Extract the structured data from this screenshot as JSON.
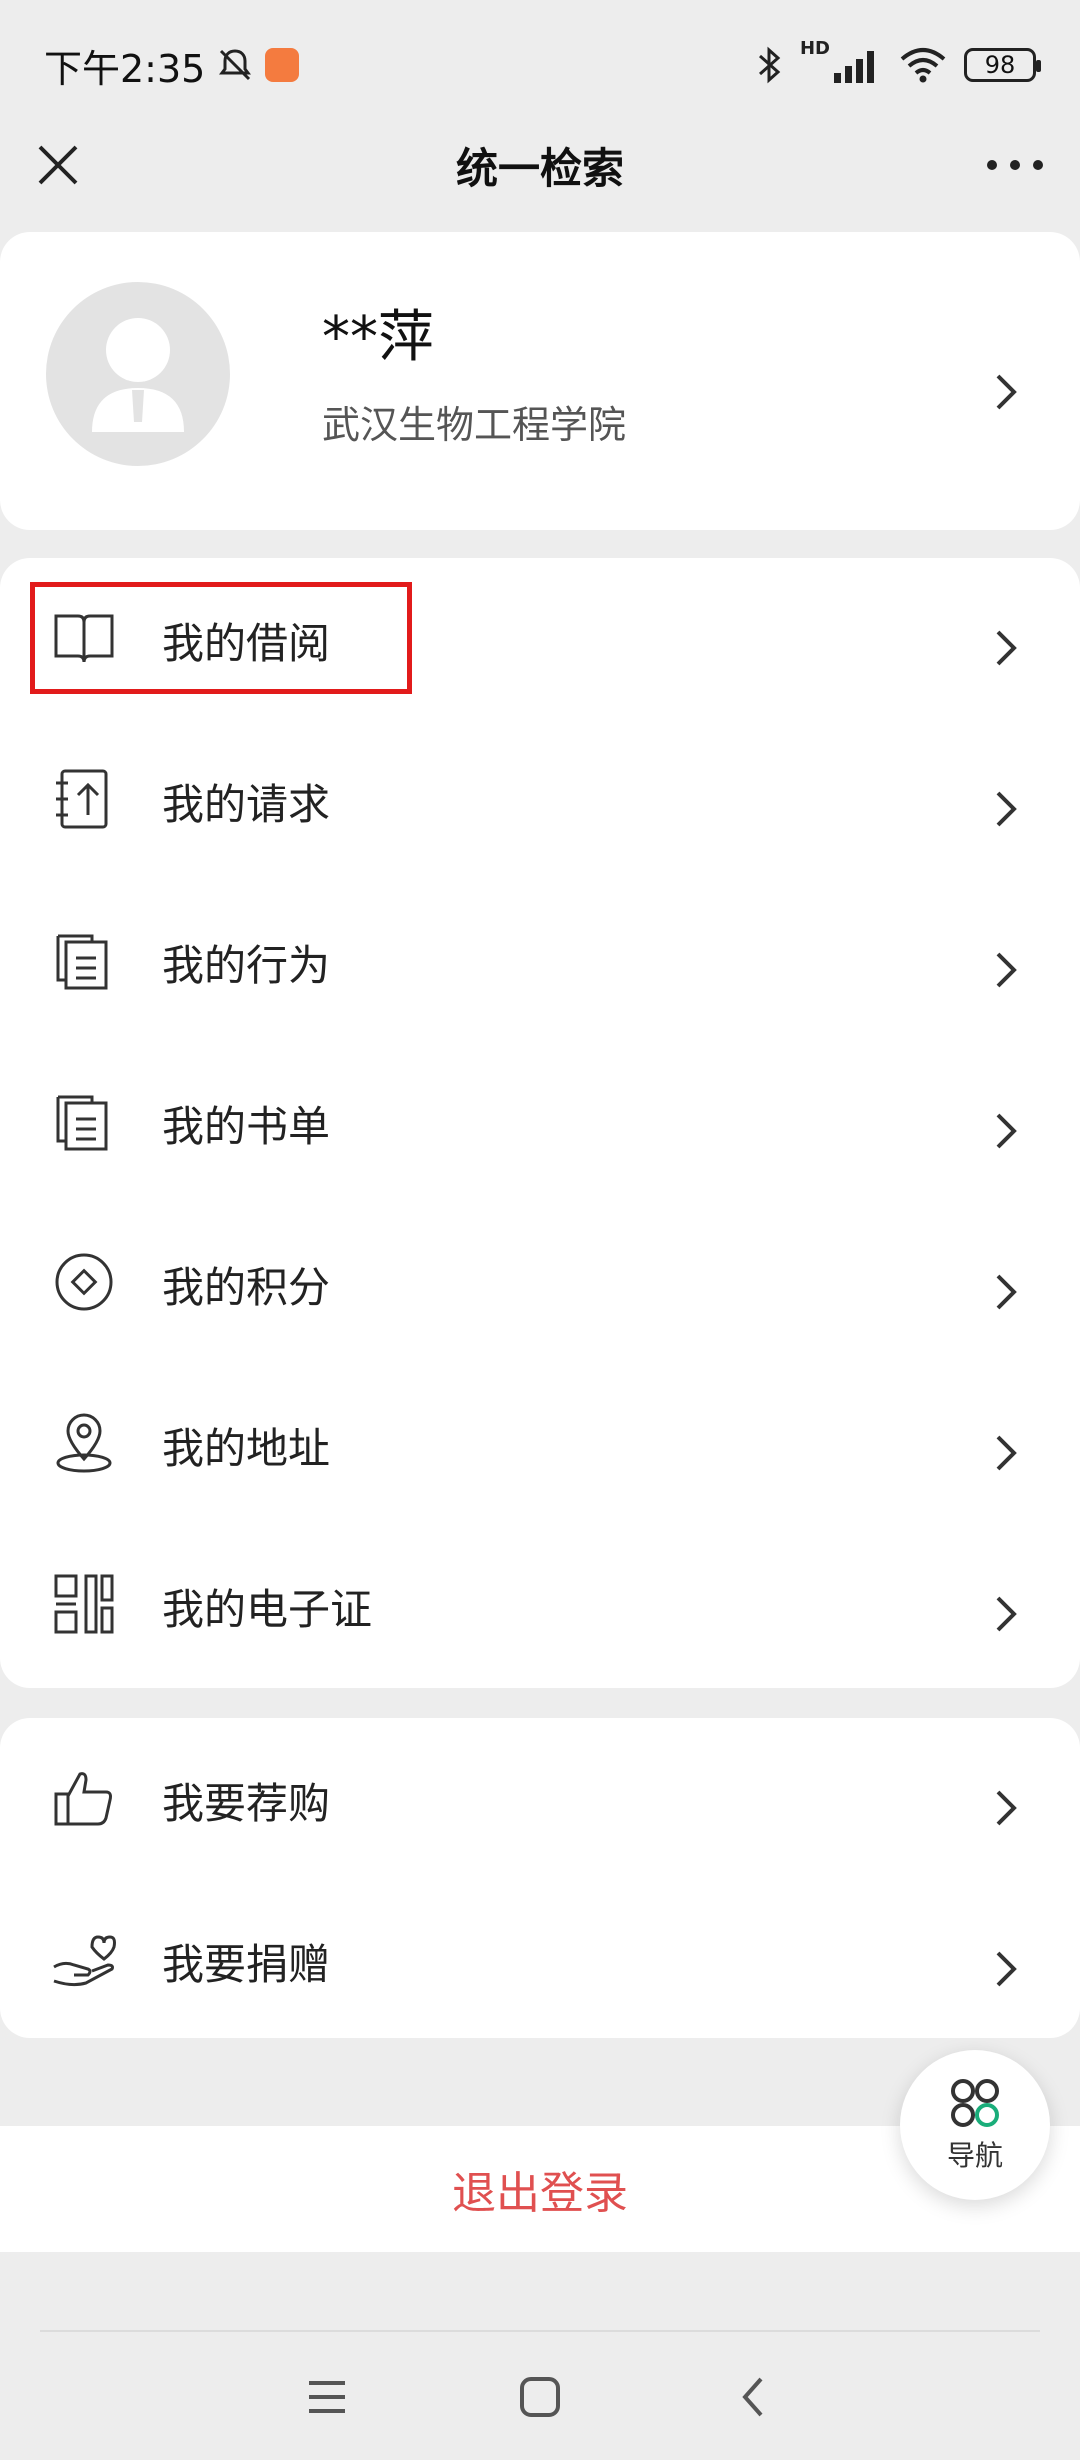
{
  "status_bar": {
    "time": "下午2:35",
    "battery": "98",
    "network": "HD"
  },
  "nav": {
    "title": "统一检索"
  },
  "profile": {
    "name": "**萍",
    "school": "武汉生物工程学院"
  },
  "menu_group_1": [
    {
      "label": "我的借阅",
      "icon": "book-icon",
      "highlighted": true
    },
    {
      "label": "我的请求",
      "icon": "request-icon"
    },
    {
      "label": "我的行为",
      "icon": "document-icon"
    },
    {
      "label": "我的书单",
      "icon": "booklist-icon"
    },
    {
      "label": "我的积分",
      "icon": "points-icon"
    },
    {
      "label": "我的地址",
      "icon": "location-icon"
    },
    {
      "label": "我的电子证",
      "icon": "qrcode-icon"
    }
  ],
  "menu_group_2": [
    {
      "label": "我要荐购",
      "icon": "thumbs-up-icon"
    },
    {
      "label": "我要捐赠",
      "icon": "donate-icon"
    }
  ],
  "logout": {
    "label": "退出登录"
  },
  "float_nav": {
    "label": "导航"
  },
  "colors": {
    "accent_red": "#e21b1b",
    "logout_text": "#e05050",
    "float_icon": "#1aad7a"
  }
}
